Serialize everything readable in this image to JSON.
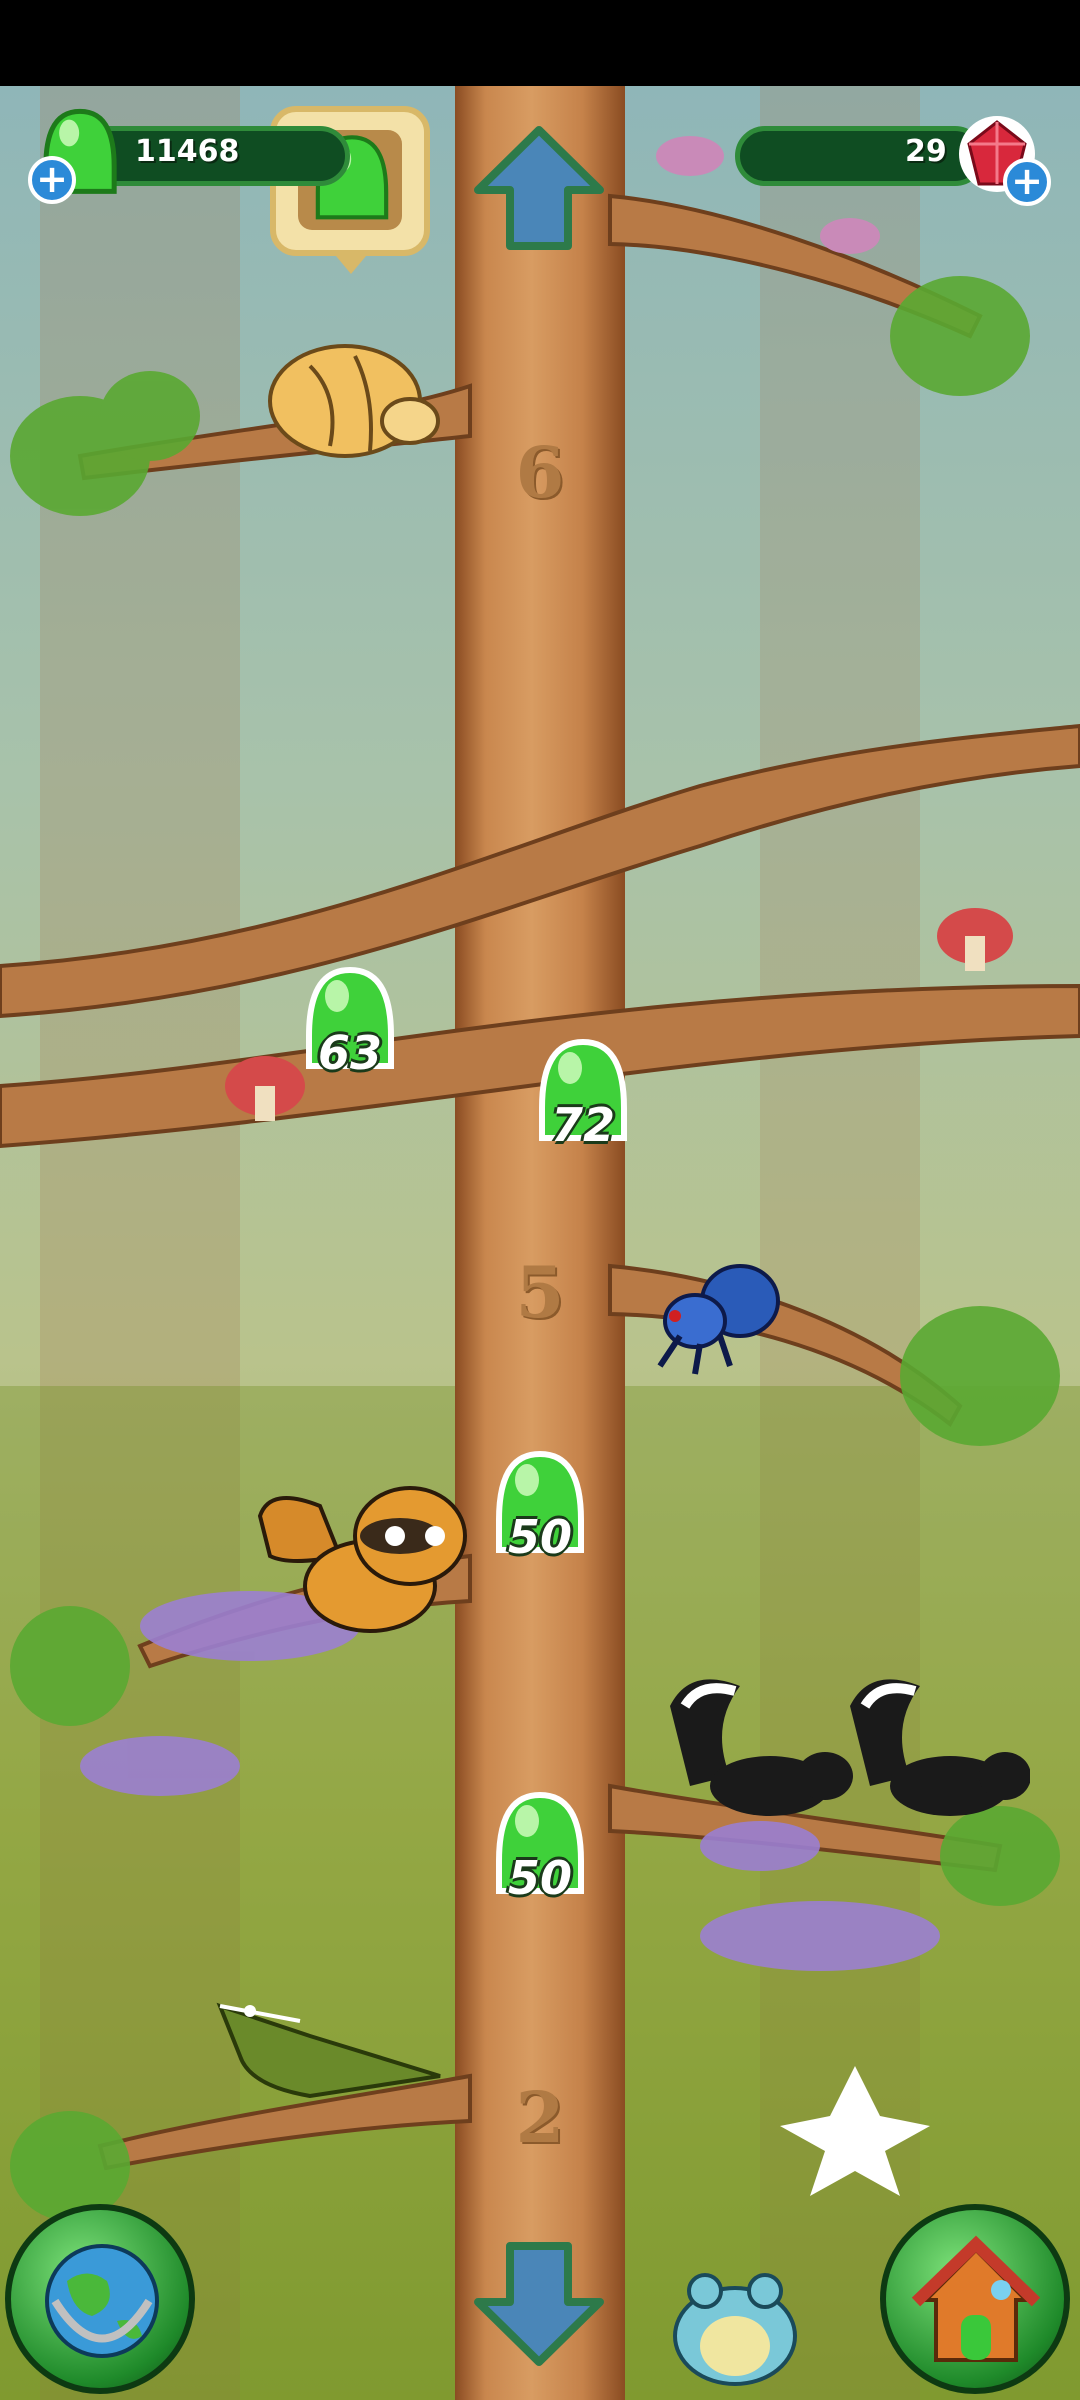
{
  "hud": {
    "goo_count": "11468",
    "gem_count": "29"
  },
  "levels": [
    {
      "label": "6"
    },
    {
      "label": "5"
    },
    {
      "label": "2"
    }
  ],
  "drops": [
    {
      "value": "63"
    },
    {
      "value": "72"
    },
    {
      "value": "50"
    },
    {
      "value": "50"
    }
  ],
  "colors": {
    "goo_green": "#3fd13a",
    "hud_bg": "#0f4d22",
    "trunk": "#c9874e",
    "arrow_blue": "#4a86b8",
    "gem_red": "#d8283c"
  },
  "icons": {
    "up": "arrow-up-icon",
    "down": "arrow-down-icon",
    "globe": "globe-icon",
    "home": "house-icon",
    "goo": "goo-drop-icon",
    "gem": "red-gem-icon"
  }
}
